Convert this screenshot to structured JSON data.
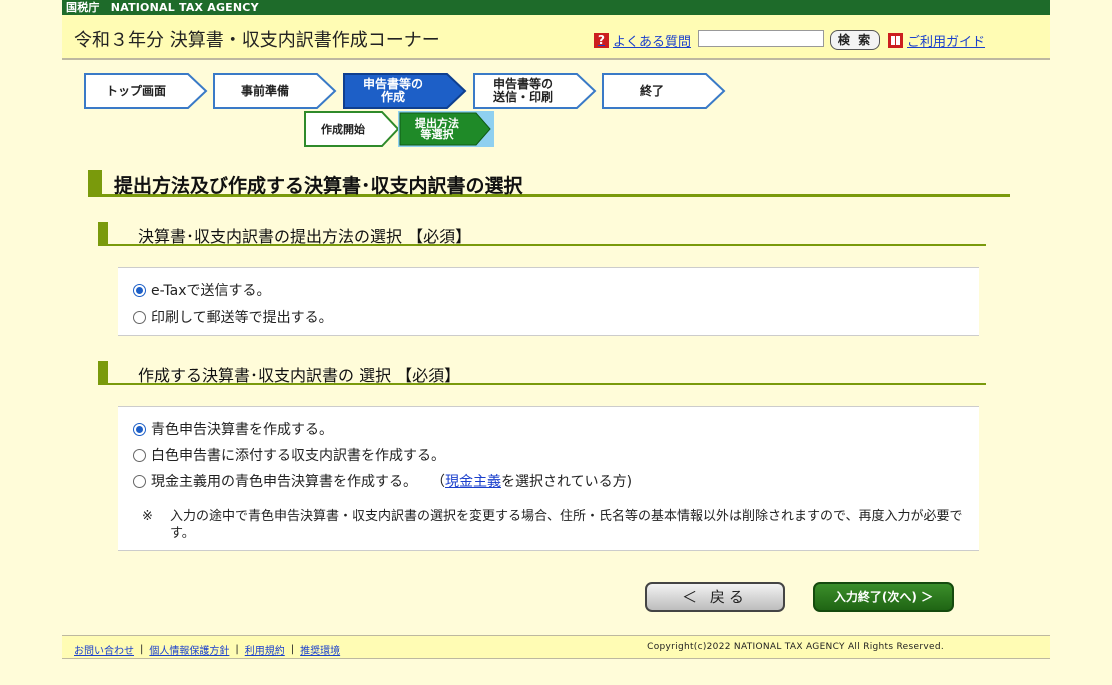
{
  "agency_bar": "国税庁　NATIONAL TAX AGENCY",
  "header": {
    "title": "令和３年分 決算書・収支内訳書作成コーナー",
    "faq": "よくある質問",
    "search_value": "",
    "search_button": "検 索",
    "guide": "ご利用ガイド"
  },
  "steps": {
    "top": "トップ画面",
    "prep": "事前準備",
    "create": "申告書等の\n作成",
    "send": "申告書等の\n送信・印刷",
    "end": "終了",
    "sub_start": "作成開始",
    "sub_method": "提出方法\n等選択"
  },
  "main": {
    "heading": "提出方法及び作成する決算書･収支内訳書の選択",
    "section1": {
      "heading": "決算書･収支内訳書の提出方法の選択 【必須】",
      "options": [
        "e-Taxで送信する。",
        "印刷して郵送等で提出する。"
      ]
    },
    "section2": {
      "heading": "作成する決算書･収支内訳書の 選択 【必須】",
      "options": [
        "青色申告決算書を作成する。",
        "白色申告書に添付する収支内訳書を作成する。",
        "現金主義用の青色申告決算書を作成する。"
      ],
      "option3_note_open": "（",
      "option3_link": "現金主義",
      "option3_note_close": "を選択されている方)",
      "note_mark": "※",
      "note": "入力の途中で青色申告決算書・収支内訳書の選択を変更する場合、住所・氏名等の基本情報以外は削除されますので、再度入力が必要です。"
    }
  },
  "buttons": {
    "back": "＜ 戻る",
    "next": "入力終了(次へ) ＞"
  },
  "footer": {
    "links": [
      "お問い合わせ",
      "個人情報保護方針",
      "利用規約",
      "推奨環境"
    ],
    "separator": "|",
    "copyright": "Copyright(c)2022 NATIONAL TAX AGENCY All Rights Reserved."
  }
}
